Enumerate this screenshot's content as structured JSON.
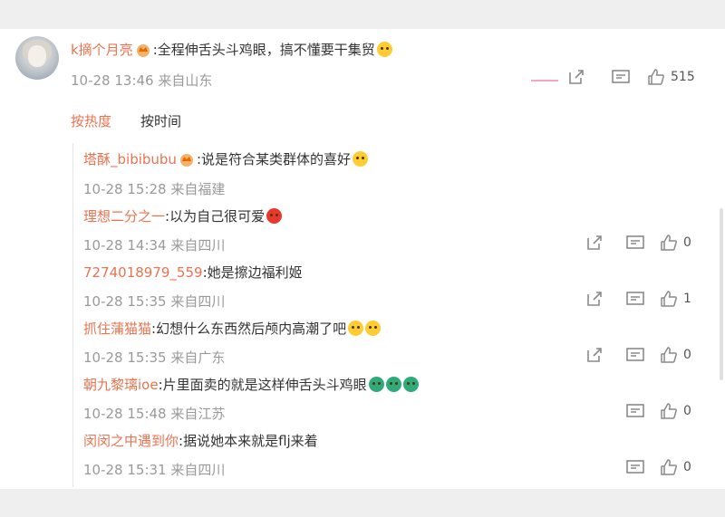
{
  "main_comment": {
    "user": "k摘个月亮",
    "text": ":全程伸舌头斗鸡眼，搞不懂要干集贸",
    "time": "10-28 13:46",
    "location": "来自山东",
    "likes": "515"
  },
  "sort_tabs": {
    "hot": "按热度",
    "time": "按时间"
  },
  "replies": [
    {
      "user": "塔酥_bibibubu",
      "text": ":说是符合某类群体的喜好",
      "time": "10-28 15:28",
      "location": "来自福建",
      "likes": ""
    },
    {
      "user": "理想二分之一",
      "text": ":以为自己很可爱",
      "time": "10-28 14:34",
      "location": "来自四川",
      "likes": "0"
    },
    {
      "user": "7274018979_559",
      "text": ":她是擦边福利姬",
      "time": "10-28 15:35",
      "location": "来自四川",
      "likes": "1"
    },
    {
      "user": "抓住蒲猫猫",
      "text": ":幻想什么东西然后颅内高潮了吧",
      "time": "10-28 15:35",
      "location": "来自广东",
      "likes": "0"
    },
    {
      "user": "朝九黎璃ioe",
      "text": ":片里面卖的就是这样伸舌头斗鸡眼",
      "time": "10-28 15:48",
      "location": "来自江苏",
      "likes": "0"
    },
    {
      "user": "闵闵之中遇到你",
      "text": ":据说她本来就是flj来着",
      "time": "10-28 15:31",
      "location": "来自四川",
      "likes": "0"
    }
  ],
  "icons": {
    "share": "share-icon",
    "comment": "comment-icon",
    "like": "thumbs-up-icon",
    "crown": "crown-badge-icon"
  },
  "colors": {
    "username": "#eb7350",
    "meta": "#9a9a9a",
    "active_tab": "#eb7350"
  }
}
